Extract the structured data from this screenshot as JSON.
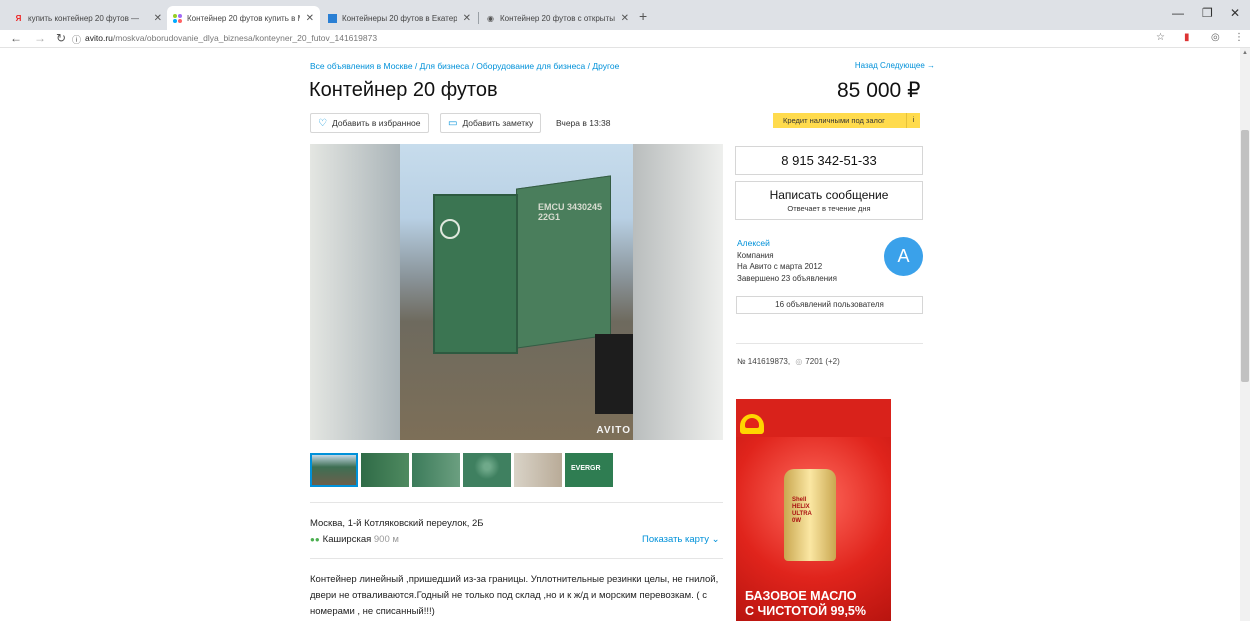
{
  "browser": {
    "tabs": [
      {
        "label": "купить контейнер 20 футов — ",
        "favicon": "Я",
        "active": false
      },
      {
        "label": "Контейнер 20 футов купить в М",
        "favicon": "avito",
        "active": true
      },
      {
        "label": "Контейнеры 20 футов в Екатер",
        "favicon": "blue",
        "active": false
      },
      {
        "label": "Контейнер 20 футов с открыты",
        "favicon": "eye",
        "active": false
      }
    ],
    "url_host": "avito.ru",
    "url_path": "/moskva/oborudovanie_dlya_biznesa/konteyner_20_futov_141619873"
  },
  "listing": {
    "breadcrumbs": "Все объявления в Москве / Для бизнеса / Оборудование для бизнеса / Другое",
    "nav_back": "Назад",
    "nav_next": "Следующее →",
    "title": "Контейнер 20 футов",
    "price": "85 000 ₽",
    "add_favorite": "Добавить в избранное",
    "add_note": "Добавить заметку",
    "date": "Вчера в 13:38",
    "credit_banner": "Кредит наличными под залог",
    "credit_info": "i",
    "photo_watermark": "AVITO",
    "container_code": "EMCU 3430245\n22G1",
    "thumb_label": "EVERGR",
    "address": "Москва, 1-й Котляковский переулок, 2Б",
    "metro_station": "Каширская",
    "metro_distance": "900 м",
    "show_map": "Показать карту",
    "description": "Контейнер линейный ,пришедший из-за границы. Уплотнительные резинки целы, не гнилой, двери не отваливаются.Годный не только под склад ,но и к ж/д и морским перевозкам. ( с номерами , не списанный!!!)"
  },
  "seller": {
    "phone": "8 915 342-51-33",
    "message_button": "Написать сообщение",
    "message_sub": "Отвечает в течение дня",
    "name": "Алексей",
    "type": "Компания",
    "since": "На Авито с марта 2012",
    "completed": "Завершено 23 объявления",
    "avatar_letter": "A",
    "all_ads": "16 объявлений пользователя",
    "ad_number": "№ 141619873,",
    "views": "7201 (+2)"
  },
  "ad_banner": {
    "bottle_text": "Shell\nHELIX\nULTRA\n0W",
    "slogan": "БАЗОВОЕ МАСЛО\nС ЧИСТОТОЙ 99,5%"
  }
}
